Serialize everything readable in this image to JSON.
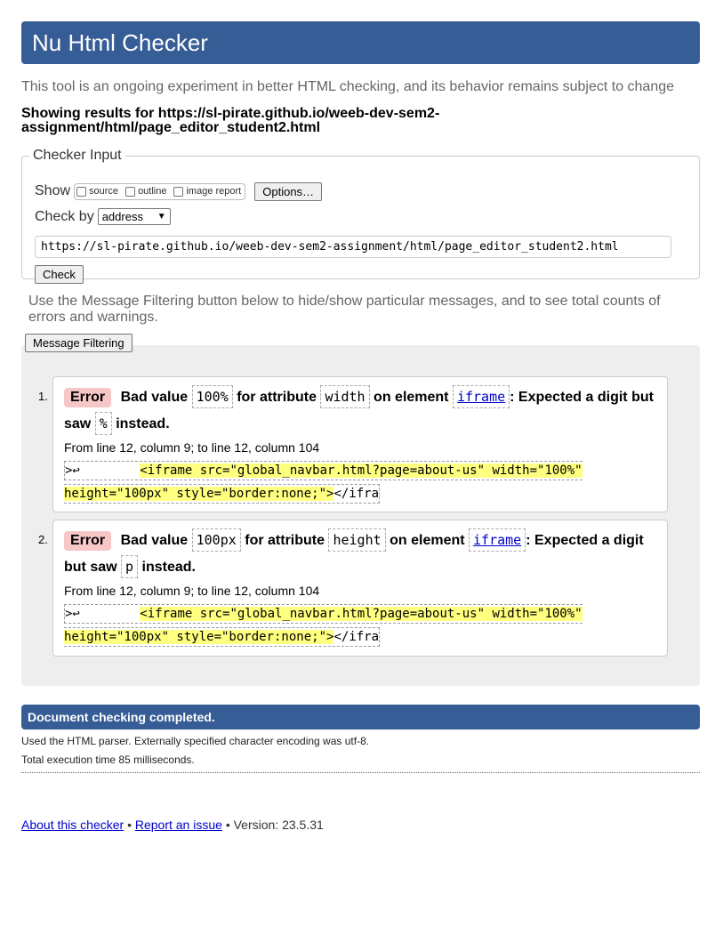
{
  "header": {
    "title": "Nu Html Checker"
  },
  "tagline": "This tool is an ongoing experiment in better HTML checking, and its behavior remains subject to change",
  "results_for": "Showing results for https://sl-pirate.github.io/weeb-dev-sem2-assignment/html/page_editor_student2.html",
  "checker_input": {
    "legend": "Checker Input",
    "show_label": "Show",
    "options": [
      "source",
      "outline",
      "image report"
    ],
    "options_button": "Options…",
    "check_by_label": "Check by",
    "check_by_value": "address",
    "url": "https://sl-pirate.github.io/weeb-dev-sem2-assignment/html/page_editor_student2.html",
    "check_button": "Check"
  },
  "filter_note": "Use the Message Filtering button below to hide/show particular messages, and to see total counts of errors and warnings.",
  "filter_button": "Message Filtering",
  "messages": [
    {
      "num": "1.",
      "type": "Error",
      "t1": "Bad value",
      "value": "100%",
      "t2": "for attribute",
      "attr": "width",
      "t3": "on element",
      "element": "iframe",
      "t4": ": Expected a digit but saw",
      "char": "%",
      "t5": "instead.",
      "location": "From line 12, column 9; to line 12, column 104",
      "extract_pre": ">↩        ",
      "extract_hl": "<iframe src=\"global_navbar.html?page=about-us\" width=\"100%\" height=\"100px\" style=\"border:none;\">",
      "extract_post": "</ifra"
    },
    {
      "num": "2.",
      "type": "Error",
      "t1": "Bad value",
      "value": "100px",
      "t2": "for attribute",
      "attr": "height",
      "t3": "on element",
      "element": "iframe",
      "t4": ": Expected a digit but saw",
      "char": "p",
      "t5": "instead.",
      "location": "From line 12, column 9; to line 12, column 104",
      "extract_pre": ">↩        ",
      "extract_hl": "<iframe src=\"global_navbar.html?page=about-us\" width=\"100%\" height=\"100px\" style=\"border:none;\">",
      "extract_post": "</ifra"
    }
  ],
  "completed": "Document checking completed.",
  "details": {
    "parser": "Used the HTML parser. Externally specified character encoding was utf-8.",
    "time": "Total execution time 85 milliseconds."
  },
  "footer": {
    "about": "About this checker",
    "sep": "•",
    "report": "Report an issue",
    "version": "Version: 23.5.31"
  }
}
